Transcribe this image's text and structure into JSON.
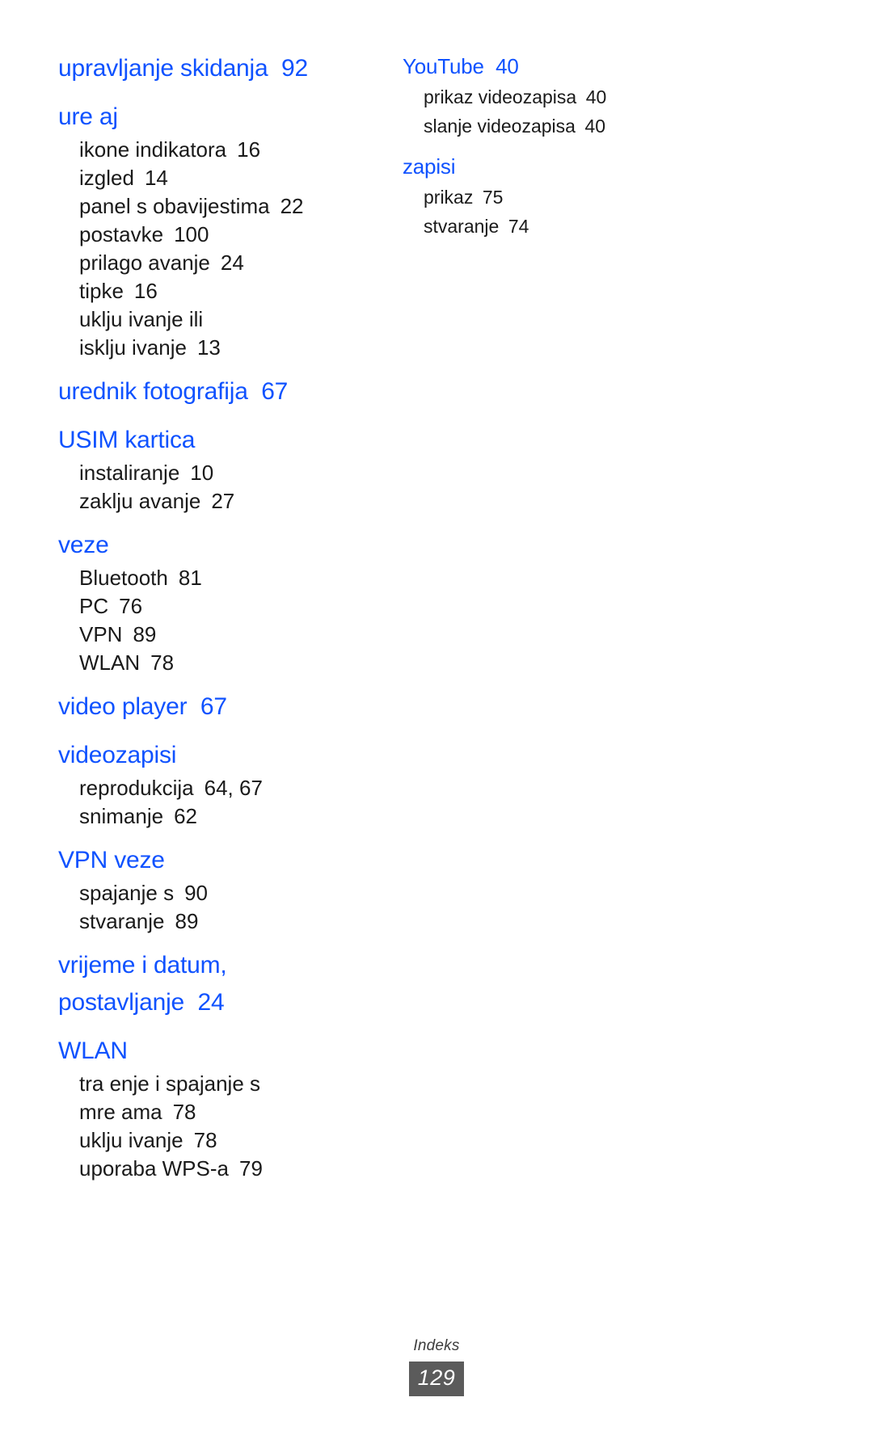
{
  "document": {
    "type": "index",
    "language": "hr"
  },
  "columns": {
    "left": [
      {
        "heading": {
          "text": "upravljanje skidanja",
          "page": "92"
        },
        "entries": []
      },
      {
        "heading": {
          "text": "ure aj",
          "page": ""
        },
        "entries": [
          {
            "text": "ikone indikatora",
            "page": "16"
          },
          {
            "text": "izgled",
            "page": "14"
          },
          {
            "text": "panel s obavijestima",
            "page": "22"
          },
          {
            "text": "postavke",
            "page": "100"
          },
          {
            "text": "prilago avanje",
            "page": "24"
          },
          {
            "text": "tipke",
            "page": "16"
          },
          {
            "lines": [
              "uklju ivanje ili",
              "isklju ivanje"
            ],
            "page": "13"
          }
        ]
      },
      {
        "heading": {
          "text": "urednik fotografija",
          "page": "67"
        },
        "entries": []
      },
      {
        "heading": {
          "text": "USIM kartica",
          "page": ""
        },
        "entries": [
          {
            "text": "instaliranje",
            "page": "10"
          },
          {
            "text": "zaklju avanje",
            "page": "27"
          }
        ]
      },
      {
        "heading": {
          "text": "veze",
          "page": ""
        },
        "entries": [
          {
            "text": "Bluetooth",
            "page": "81"
          },
          {
            "text": "PC",
            "page": "76"
          },
          {
            "text": "VPN",
            "page": "89"
          },
          {
            "text": "WLAN",
            "page": "78"
          }
        ]
      },
      {
        "heading": {
          "text": "video player",
          "page": "67"
        },
        "entries": []
      },
      {
        "heading": {
          "text": "videozapisi",
          "page": ""
        },
        "entries": [
          {
            "text": "reprodukcija",
            "page": "64, 67"
          },
          {
            "text": "snimanje",
            "page": "62"
          }
        ]
      },
      {
        "heading": {
          "text": "VPN veze",
          "page": ""
        },
        "entries": [
          {
            "text": "spajanje s",
            "page": "90"
          },
          {
            "text": "stvaranje",
            "page": "89"
          }
        ]
      },
      {
        "heading": {
          "lines": [
            "vrijeme i datum,",
            "postavljanje"
          ],
          "page": "24"
        },
        "entries": []
      },
      {
        "heading": {
          "text": "WLAN",
          "page": ""
        },
        "entries": [
          {
            "lines": [
              "tra enje i spajanje s",
              "mre ama"
            ],
            "page": "78"
          },
          {
            "text": "uklju ivanje",
            "page": "78"
          },
          {
            "text": "uporaba WPS-a",
            "page": "79"
          }
        ]
      }
    ],
    "right": [
      {
        "heading": {
          "text": "YouTube",
          "page": "40"
        },
        "entries": [
          {
            "text": "prikaz videozapisa",
            "page": "40"
          },
          {
            "text": "slanje videozapisa",
            "page": "40"
          }
        ]
      },
      {
        "heading": {
          "text": "zapisi",
          "page": ""
        },
        "entries": [
          {
            "text": "prikaz",
            "page": "75"
          },
          {
            "text": "stvaranje",
            "page": "74"
          }
        ]
      }
    ]
  },
  "footer": {
    "label": "Indeks",
    "page_number": "129"
  },
  "colors": {
    "heading": "#0f52ff",
    "entry": "#1a1a1a",
    "badge_background": "#5b5b5b",
    "badge_text": "#ffffff"
  }
}
